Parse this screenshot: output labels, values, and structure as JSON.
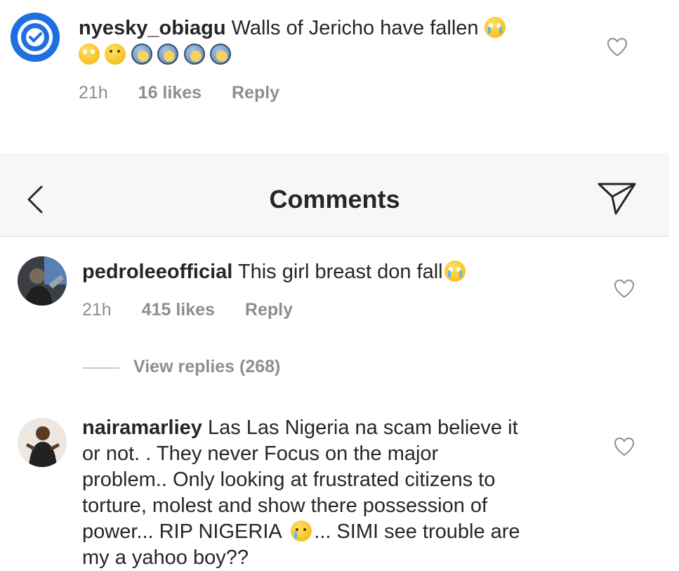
{
  "comments": [
    {
      "username": "nyesky_obiagu",
      "text": "Walls of Jericho have fallen",
      "time": "21h",
      "likes": "16 likes",
      "reply": "Reply"
    },
    {
      "username": "pedroleeofficial",
      "text": "This girl breast don fall",
      "time": "21h",
      "likes": "415 likes",
      "reply": "Reply",
      "view_replies": "View replies (268)"
    },
    {
      "username": "nairamarliey",
      "text_line1": "Las Las Nigeria na scam believe it",
      "text_line2": "or not. . They never Focus on the major",
      "text_line3": "problem.. Only looking at frustrated citizens to",
      "text_line4": "torture, molest and show there possession of",
      "text_line5a": "power... RIP NIGERIA",
      "text_line5b": "... SIMI see trouble are",
      "text_line6": "my a yahoo boy??"
    }
  ],
  "header": {
    "title": "Comments",
    "back_icon": "chevron-left-icon",
    "share_icon": "paper-plane-icon"
  }
}
